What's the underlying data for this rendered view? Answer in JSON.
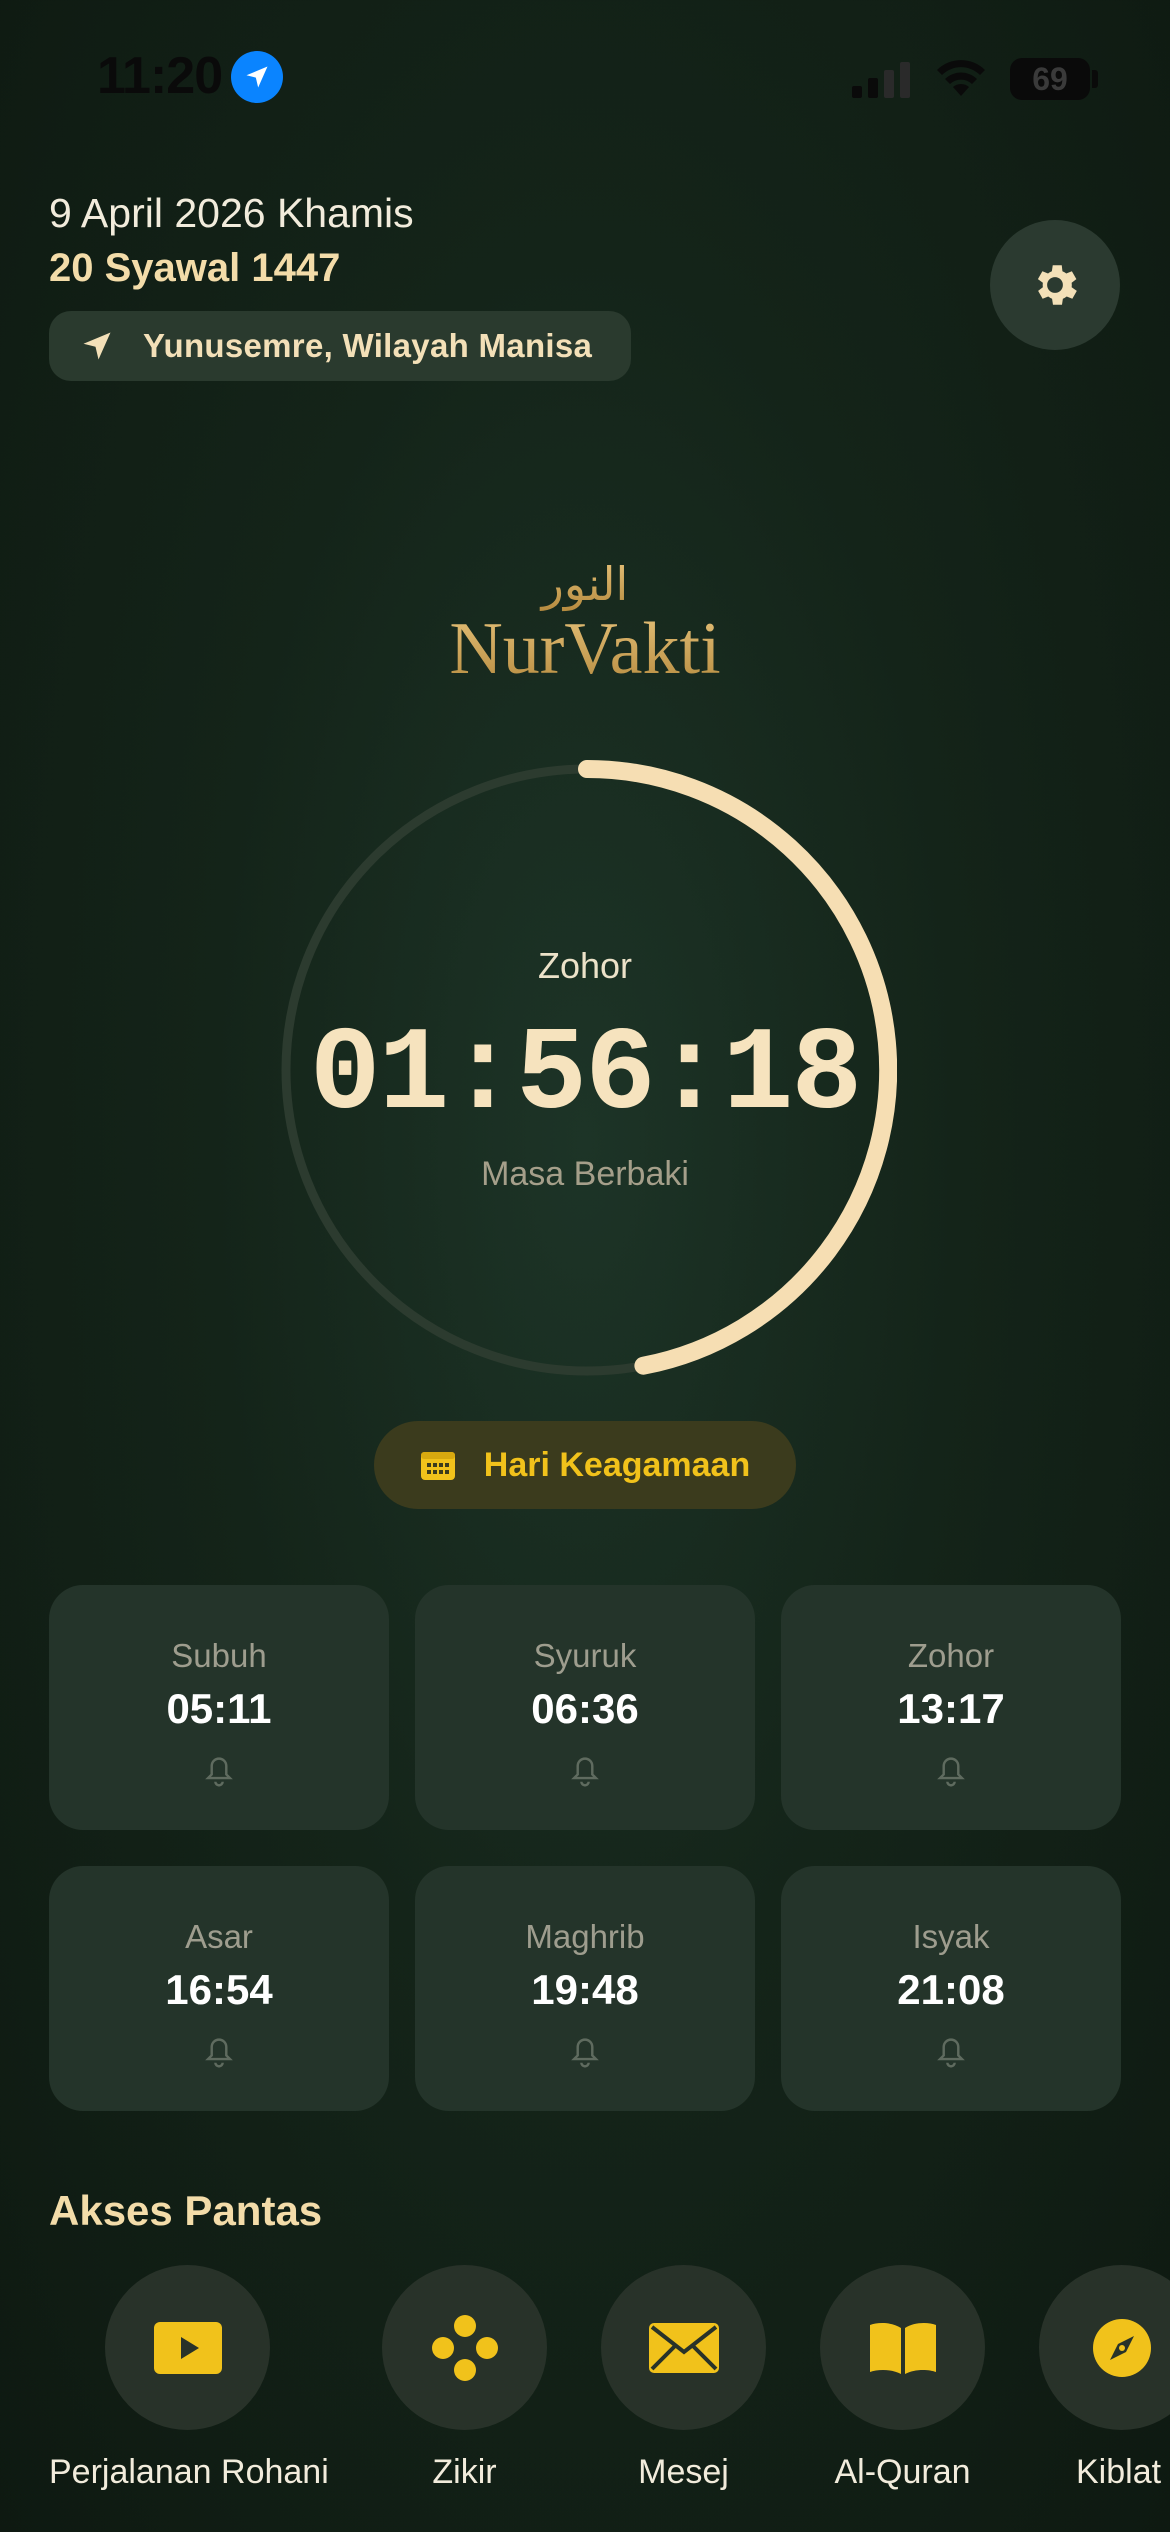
{
  "status_bar": {
    "time": "11:20",
    "battery": "69"
  },
  "header": {
    "gregorian_date": "9 April 2026 Khamis",
    "hijri_date": "20 Syawal 1447",
    "location": "Yunusemre, Wilayah Manisa"
  },
  "logo": {
    "text": "NurVakti",
    "arabic": "النور"
  },
  "countdown": {
    "prayer": "Zohor",
    "time": "01:56:18",
    "label": "Masa Berbaki",
    "progress": 0.47
  },
  "holiday_button": {
    "label": "Hari Keagamaan"
  },
  "prayers": [
    {
      "name": "Subuh",
      "time": "05:11"
    },
    {
      "name": "Syuruk",
      "time": "06:36"
    },
    {
      "name": "Zohor",
      "time": "13:17"
    },
    {
      "name": "Asar",
      "time": "16:54"
    },
    {
      "name": "Maghrib",
      "time": "19:48"
    },
    {
      "name": "Isyak",
      "time": "21:08"
    }
  ],
  "quick_access": {
    "title": "Akses Pantas",
    "items": [
      {
        "label": "Perjalanan Rohani",
        "icon": "play-icon"
      },
      {
        "label": "Zikir",
        "icon": "tasbih-icon"
      },
      {
        "label": "Mesej",
        "icon": "envelope-icon"
      },
      {
        "label": "Al-Quran",
        "icon": "book-icon"
      },
      {
        "label": "Kiblat",
        "icon": "compass-icon"
      }
    ]
  },
  "colors": {
    "accent_gold": "#f1c21b",
    "cream": "#f6e3be",
    "background": "#142419"
  }
}
